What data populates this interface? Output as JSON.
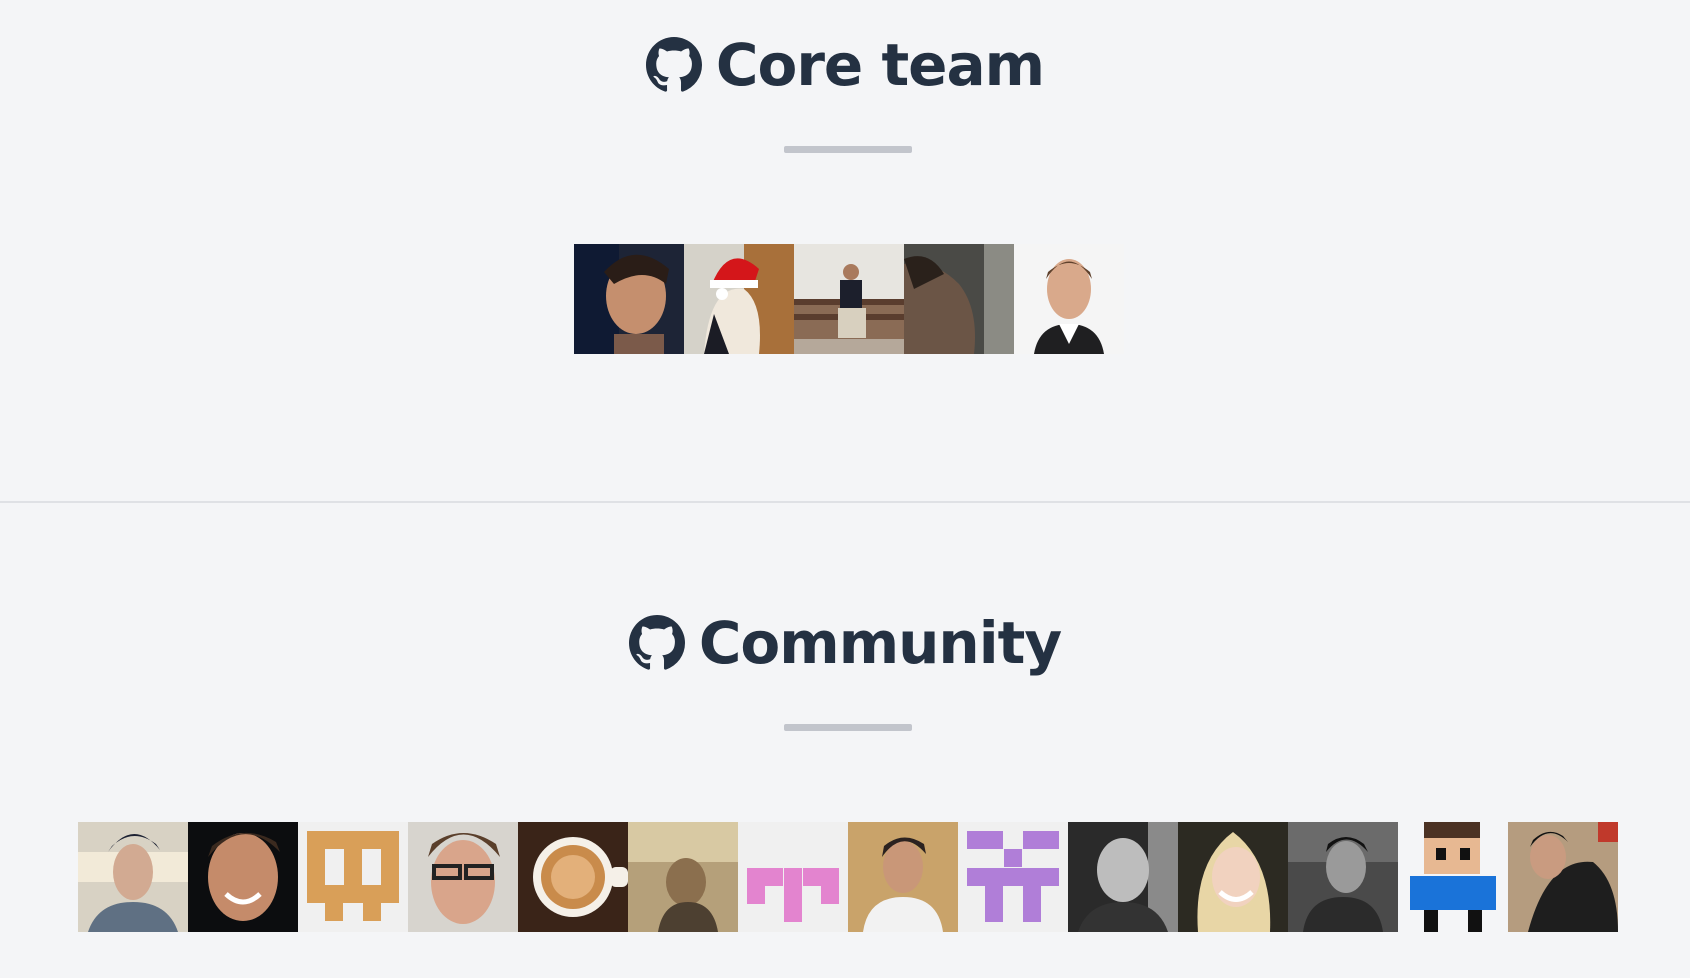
{
  "core_team": {
    "title": "Core team",
    "icon": "github-icon",
    "members": [
      {
        "avatar": "avatar-photo-man-smiling"
      },
      {
        "avatar": "avatar-photo-santa-hat"
      },
      {
        "avatar": "avatar-photo-man-on-couch"
      },
      {
        "avatar": "avatar-photo-man-looking-up"
      },
      {
        "avatar": "avatar-photo-man-portrait"
      }
    ]
  },
  "community": {
    "title": "Community",
    "icon": "github-icon",
    "members": [
      {
        "avatar": "avatar-photo-man-shirt"
      },
      {
        "avatar": "avatar-photo-man-dark"
      },
      {
        "avatar": "avatar-identicon-orange"
      },
      {
        "avatar": "avatar-photo-man-glasses"
      },
      {
        "avatar": "avatar-photo-coffee"
      },
      {
        "avatar": "avatar-photo-sepia"
      },
      {
        "avatar": "avatar-identicon-pink"
      },
      {
        "avatar": "avatar-photo-man-white-shirt"
      },
      {
        "avatar": "avatar-identicon-purple"
      },
      {
        "avatar": "avatar-photo-bald-man"
      },
      {
        "avatar": "avatar-photo-woman-smiling"
      },
      {
        "avatar": "avatar-photo-man-outdoor"
      },
      {
        "avatar": "avatar-pixel-character"
      },
      {
        "avatar": "avatar-photo-man-red-shirt"
      }
    ]
  },
  "colors": {
    "background": "#f4f5f7",
    "heading": "#243142",
    "rule": "#c2c5cc"
  }
}
